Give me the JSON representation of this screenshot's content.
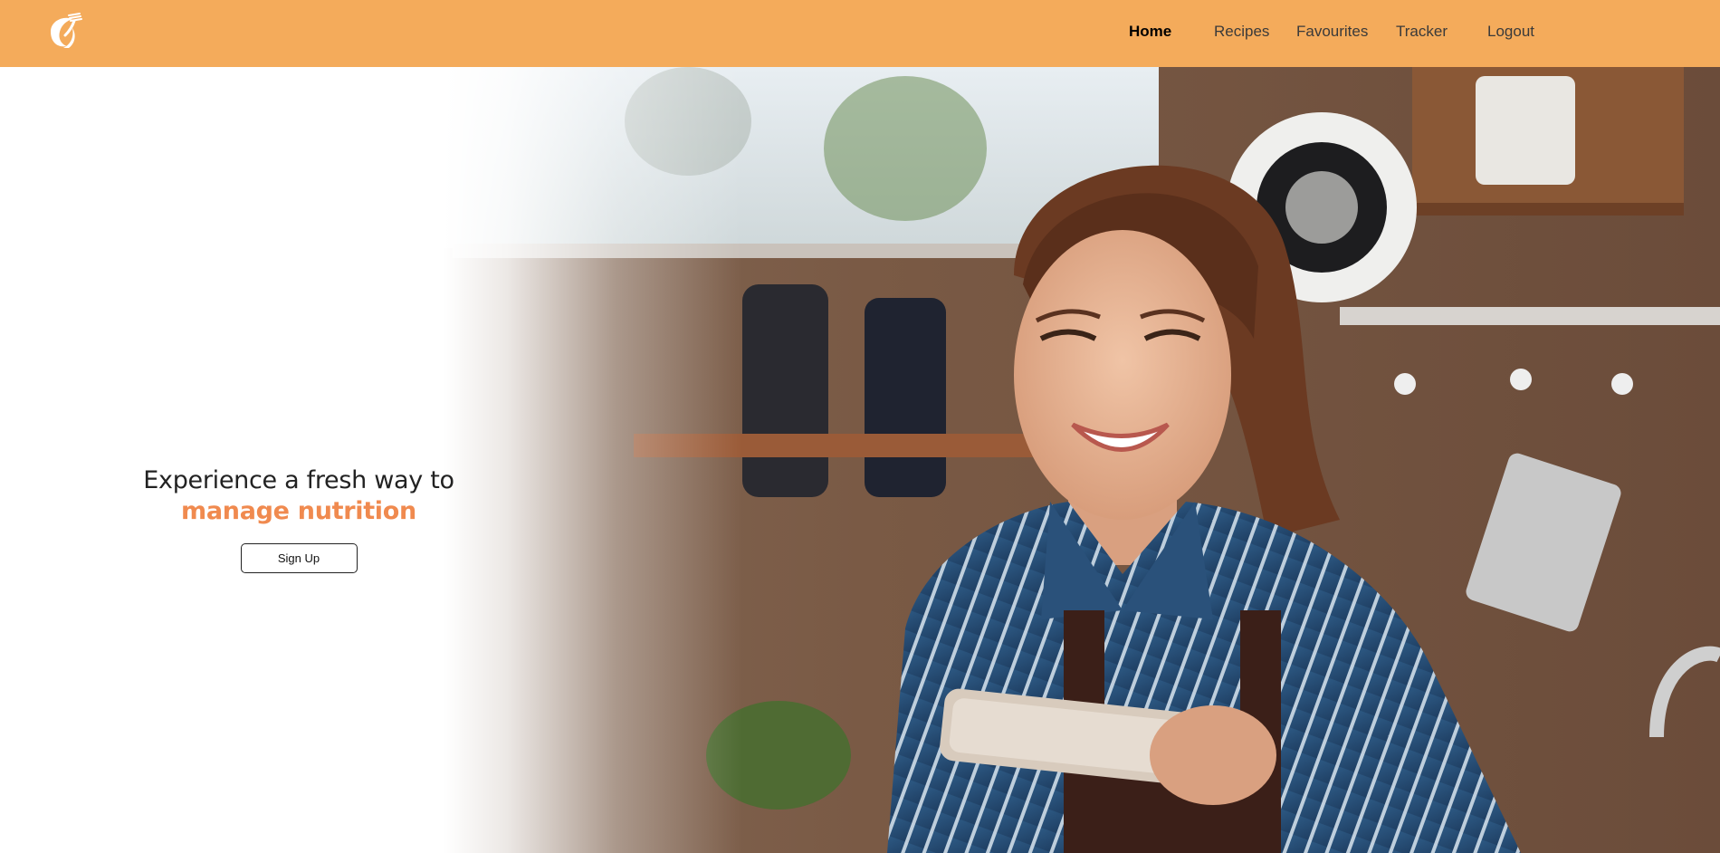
{
  "brand": {
    "logo_icon": "leaf-fork-logo-icon",
    "accent": "#f4ab5b",
    "highlight": "#f08a4f"
  },
  "nav": {
    "items": [
      {
        "label": "Home",
        "active": true
      },
      {
        "label": "Recipes",
        "active": false
      },
      {
        "label": "Favourites",
        "active": false
      },
      {
        "label": "Tracker",
        "active": false
      },
      {
        "label": "Logout",
        "active": false
      }
    ]
  },
  "hero": {
    "headline_line1": "Experience a fresh way to",
    "headline_line2": "manage nutrition",
    "cta_label": "Sign Up",
    "image": "woman-smiling-at-phone-in-kitchen"
  }
}
